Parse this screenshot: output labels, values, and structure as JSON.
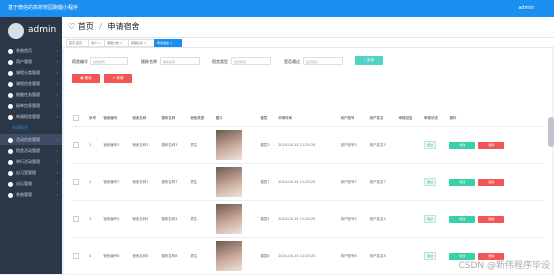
{
  "header": {
    "title": "基于微信的高校校园跑腿小程序",
    "user": "admin"
  },
  "sidebar": {
    "brand": "admin",
    "items": [
      {
        "label": "系统首页"
      },
      {
        "label": "用户管理"
      },
      {
        "label": "课程分类管理"
      },
      {
        "label": "课程信息管理"
      },
      {
        "label": "跑腿任务管理"
      },
      {
        "label": "接单信息管理"
      },
      {
        "label": "申请宿舍管理"
      },
      {
        "label": "申请宿舍",
        "sub": true
      },
      {
        "label": "活动信息管理"
      },
      {
        "label": "宿舍活动管理"
      },
      {
        "label": "举行活动管理"
      },
      {
        "label": "自习室管理"
      },
      {
        "label": "论坛管理"
      },
      {
        "label": "系统管理"
      }
    ]
  },
  "crumbs": {
    "home": "首页",
    "current": "申请宿舍"
  },
  "tabs": [
    "首页·首页",
    "用户 ×",
    "课程分类 ×",
    "跑腿任务 ×",
    "申请宿舍 ×"
  ],
  "filters": [
    {
      "label": "宿舍编号",
      "placeholder": "宿舍编号"
    },
    {
      "label": "楼栋名称",
      "placeholder": "楼栋名称"
    },
    {
      "label": "宿舍类型",
      "placeholder": "宿舍类型"
    },
    {
      "label": "是否通过",
      "placeholder": "是否通过"
    }
  ],
  "buttons": {
    "search": "查询",
    "add": "新增",
    "delete": "删除"
  },
  "table": {
    "headers": [
      "序号",
      "宿舍编号",
      "宿舍名称",
      "楼栋名称",
      "宿舍类型",
      "图片",
      "楼层",
      "申请时间",
      "用户账号",
      "用户姓名",
      "审核回复",
      "审核状态",
      "操作"
    ],
    "rows": [
      [
        "1",
        "宿舍编号3",
        "宿舍名称3",
        "楼栋名称3",
        "男生",
        "",
        "楼层3",
        "2024-04-15 11:25:20",
        "用户账号3",
        "用户姓名3",
        "",
        "通过"
      ],
      [
        "2",
        "宿舍编号7",
        "宿舍名称7",
        "楼栋名称7",
        "男生",
        "",
        "楼层7",
        "2024-04-15 11:25:20",
        "用户账号7",
        "用户姓名7",
        "",
        "通过"
      ],
      [
        "3",
        "宿舍编号4",
        "宿舍名称4",
        "楼栋名称4",
        "男生",
        "",
        "楼层4",
        "2024-04-15 11:25:20",
        "用户账号4",
        "用户姓名4",
        "",
        "通过"
      ],
      [
        "4",
        "宿舍编号8",
        "宿舍名称8",
        "楼栋名称8",
        "男生",
        "",
        "楼层8",
        "2024-04-15 11:25:20",
        "用户账号8",
        "用户姓名8",
        "",
        "通过"
      ]
    ],
    "ops": {
      "edit": "修改",
      "del": "删除"
    }
  },
  "watermark": "CSDN @新伟程序毕设"
}
